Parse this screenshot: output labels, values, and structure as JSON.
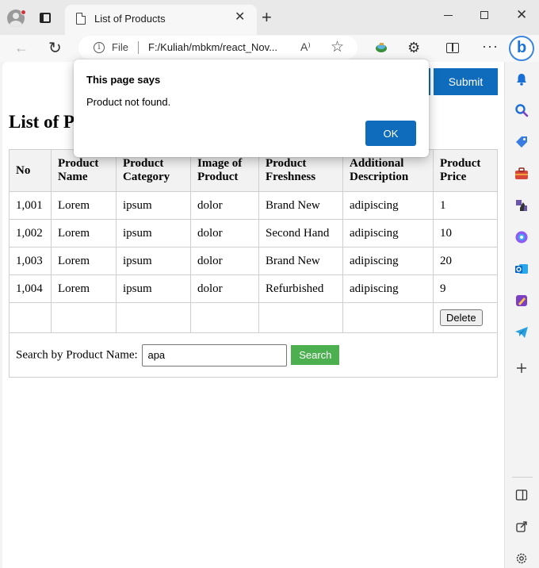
{
  "browser": {
    "tab_title": "List of Products",
    "tab_close": "✕",
    "new_tab": "+",
    "file_label": "File",
    "url": "F:/Kuliah/mbkm/react_Nov...",
    "info_glyph": "i",
    "read_aloud_glyph": "A⁾",
    "favorite_glyph": "☆",
    "extensions_glyph": "⚙",
    "more_glyph": "···",
    "bing_glyph": "b",
    "back_glyph": "←",
    "refresh_glyph": "↻",
    "close_glyph": "✕"
  },
  "page": {
    "submit_label": "Submit",
    "heading": "List of Products",
    "table": {
      "headers": [
        "No",
        "Product Name",
        "Product Category",
        "Image of Product",
        "Product Freshness",
        "Additional Description",
        "Product Price"
      ],
      "rows": [
        [
          "1,001",
          "Lorem",
          "ipsum",
          "dolor",
          "Brand New",
          "adipiscing",
          "1"
        ],
        [
          "1,002",
          "Lorem",
          "ipsum",
          "dolor",
          "Second Hand",
          "adipiscing",
          "10"
        ],
        [
          "1,003",
          "Lorem",
          "ipsum",
          "dolor",
          "Brand New",
          "adipiscing",
          "20"
        ],
        [
          "1,004",
          "Lorem",
          "ipsum",
          "dolor",
          "Refurbished",
          "adipiscing",
          "9"
        ]
      ],
      "delete_label": "Delete"
    },
    "search": {
      "label": "Search by Product Name:",
      "value": "apa",
      "button_label": "Search"
    }
  },
  "dialog": {
    "title": "This page says",
    "message": "Product not found.",
    "ok_label": "OK"
  },
  "sidebar_icons": [
    "bell-icon",
    "search-icon",
    "tag-icon",
    "toolbox-icon",
    "chess-icon",
    "copilot-icon",
    "outlook-icon",
    "designer-icon",
    "telegram-icon",
    "add-icon",
    "sidebar-panel-icon",
    "open-external-icon",
    "settings-icon"
  ],
  "colors": {
    "accent": "#0f6cbd",
    "search_button": "#4caf50",
    "table_header_bg": "#f2f2f2"
  }
}
